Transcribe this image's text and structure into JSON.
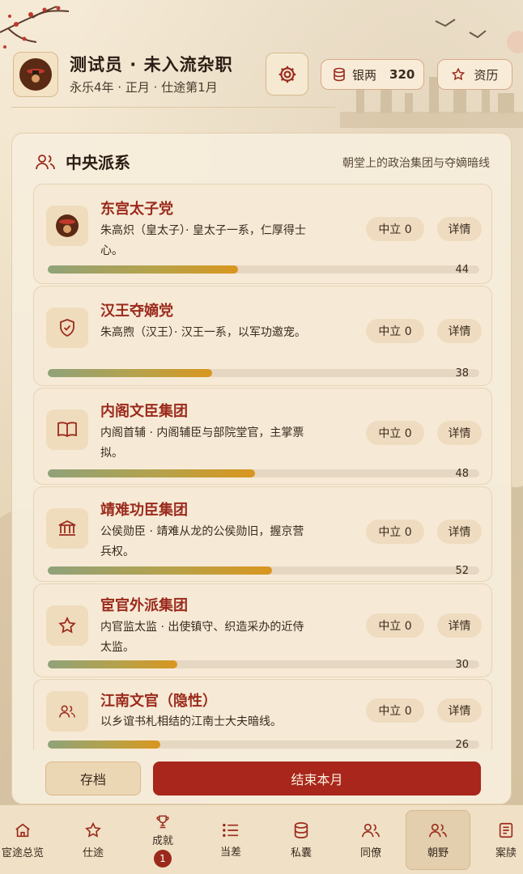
{
  "header": {
    "title": "测试员 · 未入流杂职",
    "subtitle": "永乐4年 · 正月 · 仕途第1月",
    "silver_label": "银两",
    "silver_value": "320",
    "resume_label": "资历"
  },
  "panel": {
    "title": "中央派系",
    "description": "朝堂上的政治集团与夺嫡暗线"
  },
  "factions": [
    {
      "name": "东宫太子党",
      "desc": "朱高炽（皇太子）· 皇太子一系，仁厚得士心。",
      "stance": "中立 0",
      "detail": "详情",
      "value": 44,
      "icon": "crown-avatar-icon"
    },
    {
      "name": "汉王夺嫡党",
      "desc": "朱高煦（汉王）· 汉王一系，以军功邀宠。",
      "stance": "中立 0",
      "detail": "详情",
      "value": 38,
      "icon": "shield-icon"
    },
    {
      "name": "内阁文臣集团",
      "desc": "内阁首辅 · 内阁辅臣与部院堂官，主掌票拟。",
      "stance": "中立 0",
      "detail": "详情",
      "value": 48,
      "icon": "book-icon"
    },
    {
      "name": "靖难功臣集团",
      "desc": "公侯勋臣 · 靖难从龙的公侯勋旧，握京营兵权。",
      "stance": "中立 0",
      "detail": "详情",
      "value": 52,
      "icon": "building-icon"
    },
    {
      "name": "宦官外派集团",
      "desc": "内官监太监 · 出使镇守、织造采办的近侍太监。",
      "stance": "中立 0",
      "detail": "详情",
      "value": 30,
      "icon": "star-icon"
    },
    {
      "name": "江南文官（隐性）",
      "desc": "以乡谊书札相结的江南士大夫暗线。",
      "stance": "中立 0",
      "detail": "详情",
      "value": 26,
      "icon": "users-icon"
    }
  ],
  "actions": {
    "save": "存档",
    "end_month": "结束本月"
  },
  "nav": [
    {
      "label": "宦途总览",
      "icon": "home-icon"
    },
    {
      "label": "仕途",
      "icon": "star-icon"
    },
    {
      "label": "成就",
      "icon": "trophy-icon",
      "badge": "1"
    },
    {
      "label": "当差",
      "icon": "list-icon"
    },
    {
      "label": "私囊",
      "icon": "coins-icon"
    },
    {
      "label": "同僚",
      "icon": "users-icon"
    },
    {
      "label": "朝野",
      "icon": "users-icon",
      "active": true
    },
    {
      "label": "案牍",
      "icon": "document-icon"
    }
  ],
  "colors": {
    "accent_red": "#a8261b",
    "faction_name": "#9b2a1c",
    "bar_start": "#8fa27a",
    "bar_end": "#d9961e"
  }
}
